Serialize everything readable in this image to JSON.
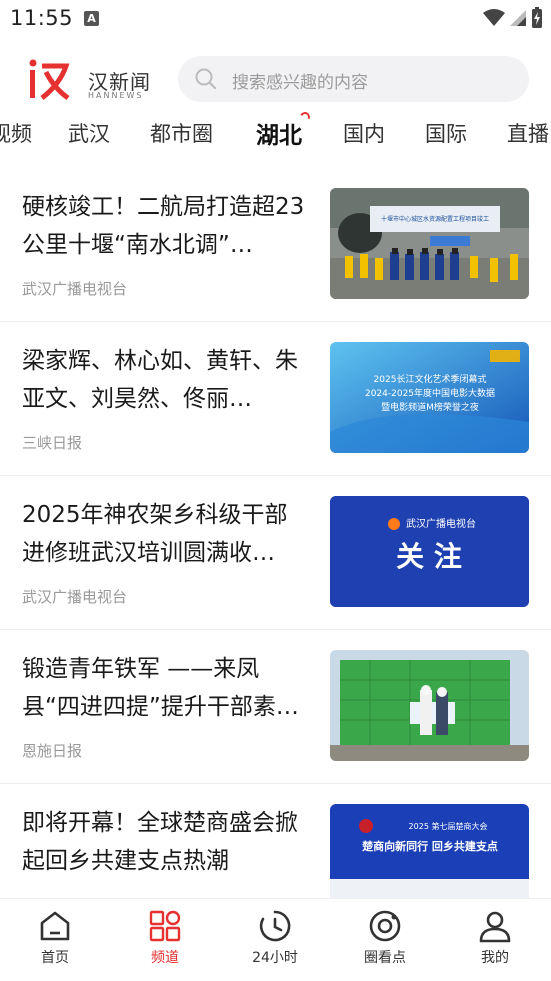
{
  "status_bar": {
    "time": "11:55",
    "notification_letter": "A"
  },
  "header": {
    "logo_cn": "汉新闻",
    "logo_en": "HANNEWS",
    "search_placeholder": "搜索感兴趣的内容"
  },
  "tabs": [
    {
      "label": "视频",
      "active": false
    },
    {
      "label": "武汉",
      "active": false
    },
    {
      "label": "都市圈",
      "active": false
    },
    {
      "label": "湖北",
      "active": true
    },
    {
      "label": "国内",
      "active": false
    },
    {
      "label": "国际",
      "active": false
    },
    {
      "label": "直播",
      "active": false
    }
  ],
  "news": [
    {
      "title": "硬核竣工！二航局打造超23公里十堰“南水北调”…",
      "source": "武汉广播电视台",
      "thumb_text": "十堰市中心城区水资源配置工程项目竣工"
    },
    {
      "title": "梁家辉、林心如、黄轩、朱亚文、刘昊然、佟丽…",
      "source": "三峡日报",
      "thumb_text": "2025长江文化艺术季闭幕式 2024-2025年度中国电影大数据暨电影频道M榜荣誉之夜"
    },
    {
      "title": "2025年神农架乡科级干部进修班武汉培训圆满收…",
      "source": "武汉广播电视台",
      "thumb_brand": "武汉广播电视台",
      "thumb_text": "关 注"
    },
    {
      "title": "锻造青年铁军 ——来凤县“四进四提”提升干部素…",
      "source": "恩施日报",
      "thumb_text": ""
    },
    {
      "title": "即将开幕！全球楚商盛会掀起回乡共建支点热潮",
      "source": "",
      "thumb_text": "第七届楚商大会 楚商向新同行 回乡共建支点"
    }
  ],
  "bottom_nav": [
    {
      "label": "首页",
      "icon": "home-icon",
      "active": false
    },
    {
      "label": "频道",
      "icon": "channel-grid-icon",
      "active": true
    },
    {
      "label": "24小时",
      "icon": "clock-icon",
      "active": false
    },
    {
      "label": "圈看点",
      "icon": "circle-view-icon",
      "active": false
    },
    {
      "label": "我的",
      "icon": "profile-icon",
      "active": false
    }
  ],
  "colors": {
    "accent": "#e5312f",
    "text": "#1a1a1a",
    "muted": "#999999",
    "search_bg": "#f2f2f4"
  }
}
